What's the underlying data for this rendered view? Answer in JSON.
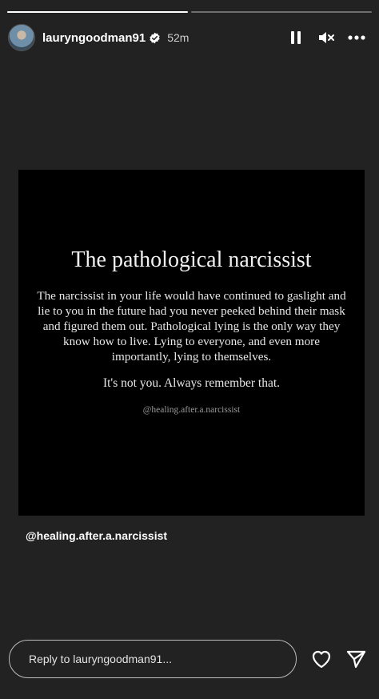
{
  "progress": {
    "segments": [
      {
        "fill_fraction": 1.0
      },
      {
        "fill_fraction": 0.0
      }
    ]
  },
  "header": {
    "username": "lauryngoodman91",
    "time": "52m"
  },
  "post": {
    "title": "The pathological narcissist",
    "body": "The narcissist in your life would have continued to gaslight and lie to you in the future had you never peeked behind their mask and figured them out. Pathological lying is the only way they know how to live. Lying to everyone, and even more importantly, lying to themselves.",
    "closing": "It's not you. Always remember that.",
    "handle": "@healing.after.a.narcissist"
  },
  "mention": {
    "label": "@healing.after.a.narcissist"
  },
  "reply": {
    "placeholder": "Reply to lauryngoodman91..."
  },
  "icons": {
    "verified": "verified-badge-icon",
    "pause": "pause-icon",
    "mute": "muted-speaker-icon",
    "more": "more-options-icon",
    "like": "heart-icon",
    "send": "send-icon"
  },
  "colors": {
    "background": "#222222",
    "post_background": "#000000",
    "text": "#ffffff"
  }
}
